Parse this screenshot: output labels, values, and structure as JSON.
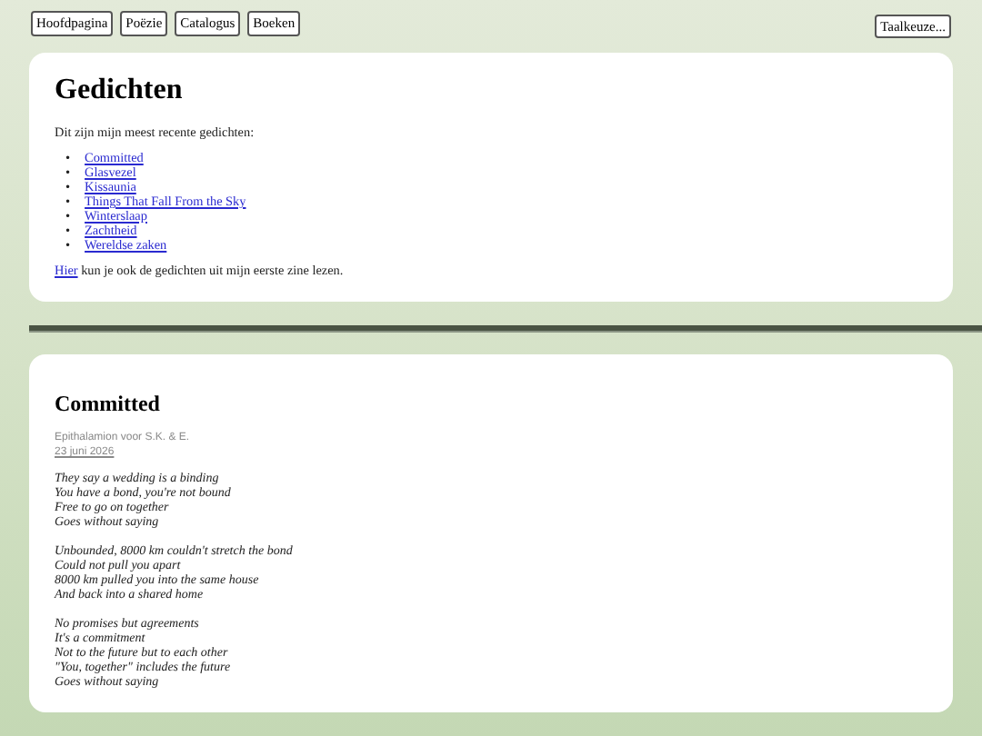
{
  "nav": {
    "items": [
      "Hoofdpagina",
      "Poëzie",
      "Catalogus",
      "Boeken"
    ],
    "language_button": "Taalkeuze..."
  },
  "overview": {
    "title": "Gedichten",
    "intro": "Dit zijn mijn meest recente gedichten:",
    "poems": [
      {
        "bullet": "•",
        "title": "Committed"
      },
      {
        "bullet": "•",
        "title": "Glasvezel"
      },
      {
        "bullet": "•",
        "title": "Kissaunia"
      },
      {
        "bullet": "•",
        "title": "Things That Fall From the Sky"
      },
      {
        "bullet": "•",
        "title": "Winterslaap"
      },
      {
        "bullet": "•",
        "title": "Zachtheid"
      },
      {
        "bullet": "•",
        "title": "Wereldse zaken"
      }
    ],
    "footer": {
      "link": "Hier",
      "text": "kun je ook de gedichten uit mijn eerste zine lezen."
    }
  },
  "poem": {
    "title": "Committed",
    "subtitle": "Epithalamion voor S.K. & E.",
    "date": "23 juni 2026",
    "stanzas": [
      [
        "They say a wedding is a binding",
        "You have a bond, you're not bound",
        "Free to go on together",
        "Goes without saying"
      ],
      [
        "Unbounded, 8000 km couldn't stretch the bond",
        "Could not pull you apart",
        "8000 km pulled you into the same house",
        "And back into a shared home"
      ],
      [
        "No promises but agreements",
        "It's a commitment",
        "Not to the future but to each other",
        "\"You, together\" includes the future",
        "Goes without saying"
      ]
    ]
  }
}
